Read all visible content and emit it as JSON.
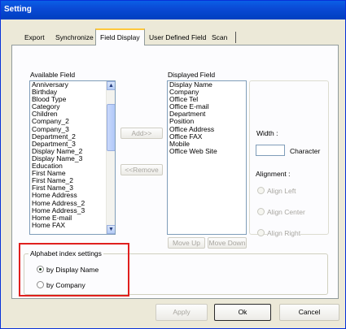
{
  "window": {
    "title": "Setting"
  },
  "tabs": [
    {
      "label": "Export"
    },
    {
      "label": "Synchronize"
    },
    {
      "label": "Field Display"
    },
    {
      "label": "User Defined Field"
    },
    {
      "label": "Scan"
    }
  ],
  "active_tab": "Field Display",
  "available": {
    "label": "Available Field",
    "items": [
      "Anniversary",
      "Birthday",
      "Blood Type",
      "Category",
      "Children",
      "Company_2",
      "Company_3",
      "Department_2",
      "Department_3",
      "Display Name_2",
      "Display Name_3",
      "Education",
      "First Name",
      "First Name_2",
      "First Name_3",
      "Home Address",
      "Home Address_2",
      "Home Address_3",
      "Home E-mail",
      "Home FAX"
    ]
  },
  "displayed": {
    "label": "Displayed Field",
    "items": [
      "Display Name",
      "Company",
      "Office Tel",
      "Office E-mail",
      "Department",
      "Position",
      "Office Address",
      "Office FAX",
      "Mobile",
      "Office Web Site"
    ]
  },
  "buttons": {
    "add": "Add>>",
    "remove": "<<Remove",
    "move_up": "Move Up",
    "move_down": "Move Down",
    "apply": "Apply",
    "ok": "Ok",
    "cancel": "Cancel"
  },
  "properties": {
    "width_label": "Width :",
    "character_label": "Character",
    "alignment_label": "Alignment :",
    "align_left": "Align Left",
    "align_center": "Align Center",
    "align_right": "Align Right"
  },
  "alphabet_index": {
    "title": "Alphabet index settings",
    "option_display_name": "by Display Name",
    "option_company": "by Company",
    "selected": "by Display Name"
  },
  "colors": {
    "title_bar": "#0a4ad6",
    "highlight": "#e0201e"
  }
}
